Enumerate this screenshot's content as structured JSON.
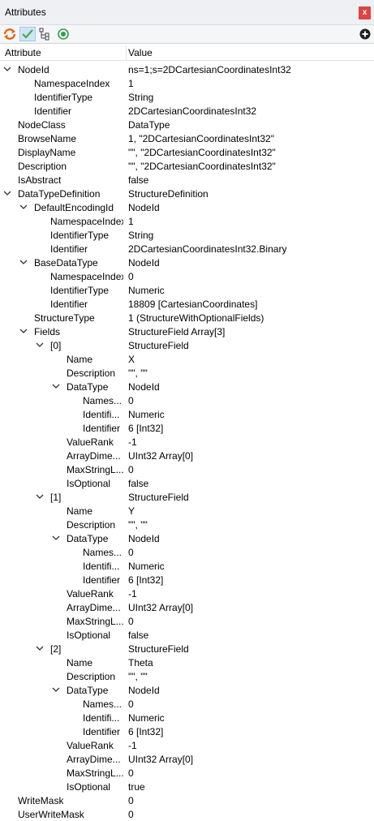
{
  "window": {
    "title": "Attributes",
    "close_label": "x"
  },
  "toolbar": [
    "refresh-icon",
    "check-icon",
    "tree-icon",
    "target-icon",
    "add-icon"
  ],
  "columns": {
    "attribute": "Attribute",
    "value": "Value"
  },
  "rows": [
    {
      "label": "NodeId",
      "value": "ns=1;s=2DCartesianCoordinatesInt32",
      "depth": 0,
      "expanded": true
    },
    {
      "label": "NamespaceIndex",
      "value": "1",
      "depth": 1
    },
    {
      "label": "IdentifierType",
      "value": "String",
      "depth": 1
    },
    {
      "label": "Identifier",
      "value": "2DCartesianCoordinatesInt32",
      "depth": 1
    },
    {
      "label": "NodeClass",
      "value": "DataType",
      "depth": 0
    },
    {
      "label": "BrowseName",
      "value": "1, \"2DCartesianCoordinatesInt32\"",
      "depth": 0
    },
    {
      "label": "DisplayName",
      "value": "\"\", \"2DCartesianCoordinatesInt32\"",
      "depth": 0
    },
    {
      "label": "Description",
      "value": "\"\", \"2DCartesianCoordinatesInt32\"",
      "depth": 0
    },
    {
      "label": "IsAbstract",
      "value": "false",
      "depth": 0
    },
    {
      "label": "DataTypeDefinition",
      "value": "StructureDefinition",
      "depth": 0,
      "expanded": true
    },
    {
      "label": "DefaultEncodingId",
      "value": "NodeId",
      "depth": 1,
      "expanded": true
    },
    {
      "label": "NamespaceIndex",
      "value": "1",
      "depth": 2
    },
    {
      "label": "IdentifierType",
      "value": "String",
      "depth": 2
    },
    {
      "label": "Identifier",
      "value": "2DCartesianCoordinatesInt32.Binary",
      "depth": 2
    },
    {
      "label": "BaseDataType",
      "value": "NodeId",
      "depth": 1,
      "expanded": true
    },
    {
      "label": "NamespaceIndex",
      "value": "0",
      "depth": 2
    },
    {
      "label": "IdentifierType",
      "value": "Numeric",
      "depth": 2
    },
    {
      "label": "Identifier",
      "value": "18809 [CartesianCoordinates]",
      "depth": 2
    },
    {
      "label": "StructureType",
      "value": "1 (StructureWithOptionalFields)",
      "depth": 1
    },
    {
      "label": "Fields",
      "value": "StructureField Array[3]",
      "depth": 1,
      "expanded": true
    },
    {
      "label": "[0]",
      "value": "StructureField",
      "depth": 2,
      "expanded": true
    },
    {
      "label": "Name",
      "value": "X",
      "depth": 3
    },
    {
      "label": "Description",
      "value": "\"\", \"\"",
      "depth": 3
    },
    {
      "label": "DataType",
      "value": "NodeId",
      "depth": 3,
      "expanded": true
    },
    {
      "label": "Names...",
      "value": "0",
      "depth": 4
    },
    {
      "label": "Identifi...",
      "value": "Numeric",
      "depth": 4
    },
    {
      "label": "Identifier",
      "value": "6 [Int32]",
      "depth": 4
    },
    {
      "label": "ValueRank",
      "value": "-1",
      "depth": 3
    },
    {
      "label": "ArrayDime...",
      "value": "UInt32 Array[0]",
      "depth": 3
    },
    {
      "label": "MaxStringL...",
      "value": "0",
      "depth": 3
    },
    {
      "label": "IsOptional",
      "value": "false",
      "depth": 3
    },
    {
      "label": "[1]",
      "value": "StructureField",
      "depth": 2,
      "expanded": true
    },
    {
      "label": "Name",
      "value": "Y",
      "depth": 3
    },
    {
      "label": "Description",
      "value": "\"\", \"\"",
      "depth": 3
    },
    {
      "label": "DataType",
      "value": "NodeId",
      "depth": 3,
      "expanded": true
    },
    {
      "label": "Names...",
      "value": "0",
      "depth": 4
    },
    {
      "label": "Identifi...",
      "value": "Numeric",
      "depth": 4
    },
    {
      "label": "Identifier",
      "value": "6 [Int32]",
      "depth": 4
    },
    {
      "label": "ValueRank",
      "value": "-1",
      "depth": 3
    },
    {
      "label": "ArrayDime...",
      "value": "UInt32 Array[0]",
      "depth": 3
    },
    {
      "label": "MaxStringL...",
      "value": "0",
      "depth": 3
    },
    {
      "label": "IsOptional",
      "value": "false",
      "depth": 3
    },
    {
      "label": "[2]",
      "value": "StructureField",
      "depth": 2,
      "expanded": true
    },
    {
      "label": "Name",
      "value": "Theta",
      "depth": 3
    },
    {
      "label": "Description",
      "value": "\"\", \"\"",
      "depth": 3
    },
    {
      "label": "DataType",
      "value": "NodeId",
      "depth": 3,
      "expanded": true
    },
    {
      "label": "Names...",
      "value": "0",
      "depth": 4
    },
    {
      "label": "Identifi...",
      "value": "Numeric",
      "depth": 4
    },
    {
      "label": "Identifier",
      "value": "6 [Int32]",
      "depth": 4
    },
    {
      "label": "ValueRank",
      "value": "-1",
      "depth": 3
    },
    {
      "label": "ArrayDime...",
      "value": "UInt32 Array[0]",
      "depth": 3
    },
    {
      "label": "MaxStringL...",
      "value": "0",
      "depth": 3
    },
    {
      "label": "IsOptional",
      "value": "true",
      "depth": 3
    },
    {
      "label": "WriteMask",
      "value": "0",
      "depth": 0
    },
    {
      "label": "UserWriteMask",
      "value": "0",
      "depth": 0
    }
  ]
}
